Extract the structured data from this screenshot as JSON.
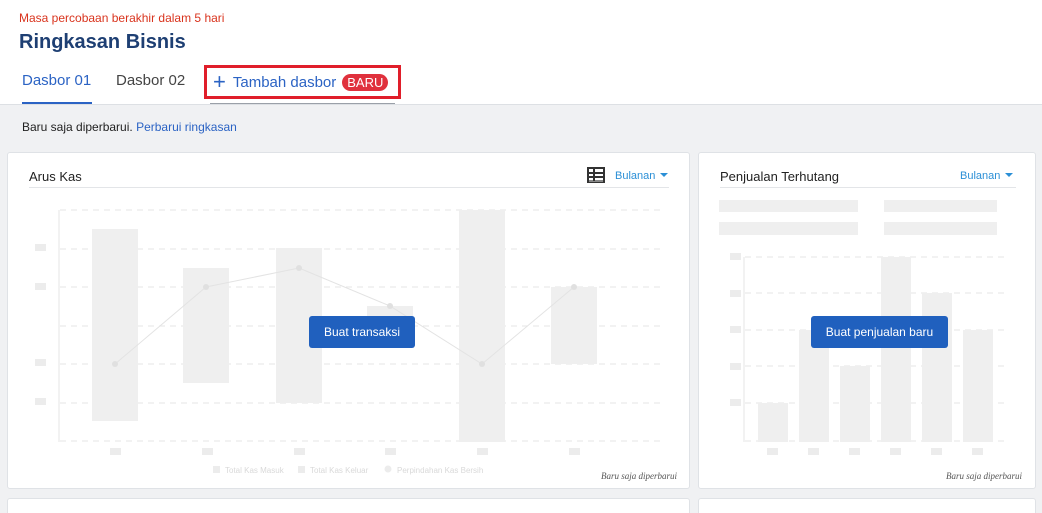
{
  "header": {
    "trial_notice": "Masa percobaan berakhir dalam 5 hari",
    "title": "Ringkasan Bisnis",
    "tabs": [
      {
        "label": "Dasbor 01",
        "active": true
      },
      {
        "label": "Dasbor 02",
        "active": false
      }
    ],
    "add_tab": {
      "label": "Tambah dasbor",
      "badge": "BARU",
      "icon": "plus-icon"
    }
  },
  "status": {
    "text": "Baru saja diperbarui.",
    "link": "Perbarui ringkasan"
  },
  "cards": {
    "cashflow": {
      "title": "Arus Kas",
      "period": "Bulanan",
      "icon": "table-view-icon",
      "cta": "Buat transaksi",
      "footnote": "Baru saja diperbarui",
      "legend": [
        "Total Kas Masuk",
        "Total Kas Keluar",
        "Perpindahan Kas Bersih"
      ]
    },
    "receivables": {
      "title": "Penjualan Terhutang",
      "period": "Bulanan",
      "cta": "Buat penjualan baru",
      "footnote": "Baru saja diperbarui"
    }
  },
  "colors": {
    "accent": "#2b63c4",
    "cta": "#2060be",
    "trial": "#d9341e",
    "badge": "#e0313d",
    "highlight_box": "#e01e2a",
    "placeholder": "#efefef"
  }
}
